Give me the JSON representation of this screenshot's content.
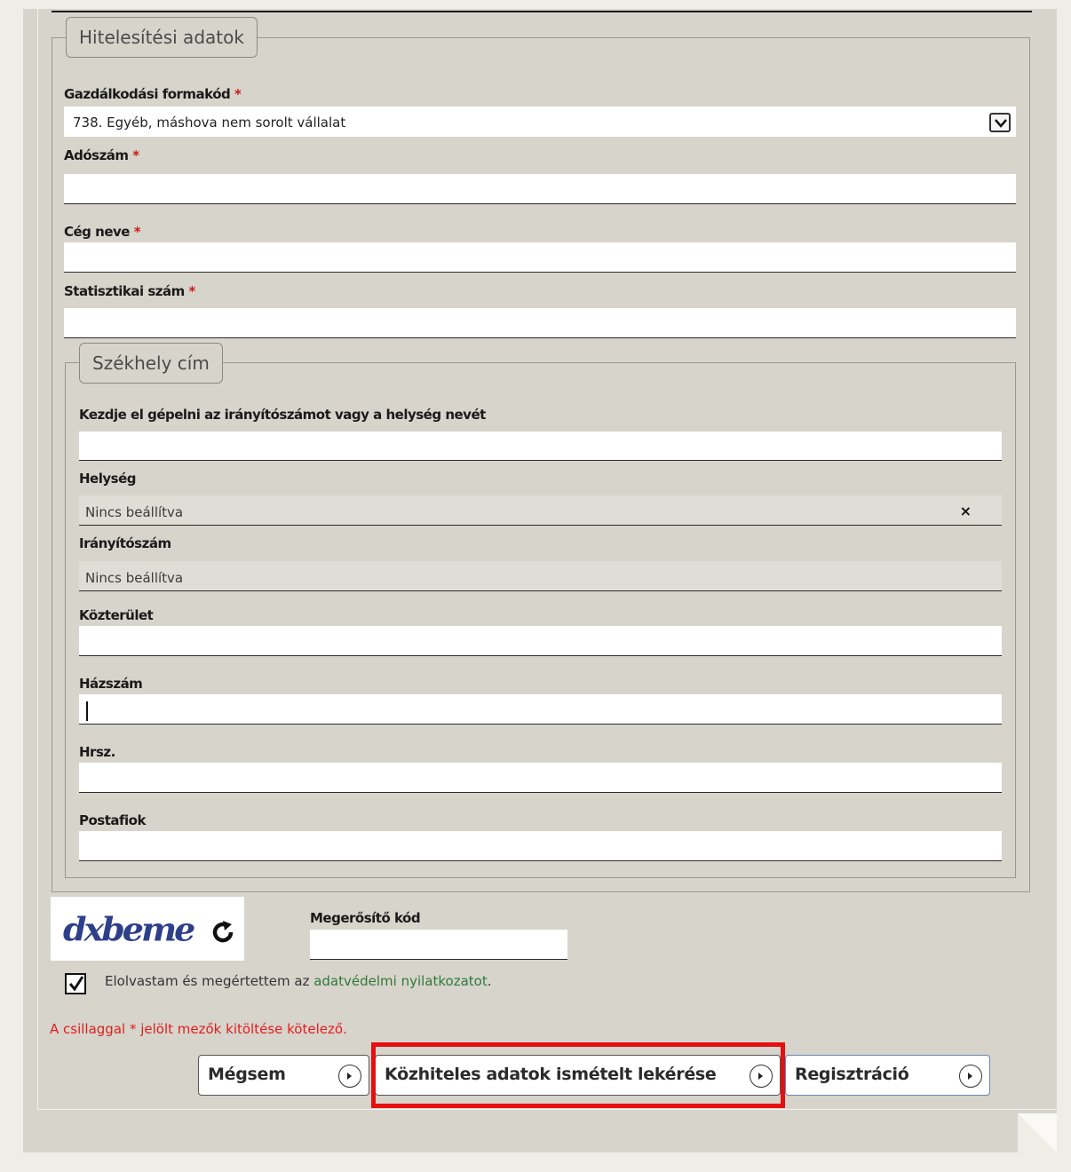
{
  "fieldset_main": {
    "legend": "Hitelesítési adatok"
  },
  "fields": {
    "business_form": {
      "label": "Gazdálkodási formakód",
      "required": "*",
      "value": "738. Egyéb, máshova nem sorolt vállalat"
    },
    "tax_number": {
      "label": "Adószám",
      "required": "*",
      "value": ""
    },
    "company_name": {
      "label": "Cég neve",
      "required": "*",
      "value": ""
    },
    "stat_number": {
      "label": "Statisztikai szám",
      "required": "*",
      "value": ""
    }
  },
  "address": {
    "legend": "Székhely cím",
    "search": {
      "label": "Kezdje el gépelni az irányítószámot vagy a helység nevét",
      "value": ""
    },
    "city": {
      "label": "Helység",
      "value": "Nincs beállítva",
      "clear_icon": "×"
    },
    "zip": {
      "label": "Irányítószám",
      "value": "Nincs beállítva"
    },
    "street": {
      "label": "Közterület",
      "value": ""
    },
    "house_number": {
      "label": "Házszám",
      "value": ""
    },
    "parcel": {
      "label": "Hrsz.",
      "value": ""
    },
    "po_box": {
      "label": "Postafiok",
      "value": ""
    }
  },
  "captcha": {
    "image_text": "dxbeme",
    "code_label": "Megerősítő kód",
    "code_value": "",
    "refresh_icon": "refresh-icon"
  },
  "consent": {
    "checked": true,
    "text": "Elolvastam és megértettem az ",
    "link": "adatvédelmi nyilatkozatot",
    "suffix": "."
  },
  "required_note": "A csillaggal * jelölt mezők kitöltése kötelező.",
  "buttons": {
    "cancel": "Mégsem",
    "refetch": "Közhiteles adatok ismételt lekérése",
    "register": "Regisztráció"
  },
  "colors": {
    "highlight": "#e60f0f",
    "required": "#cc1b1b",
    "link": "#2e7a3a",
    "panel": "#d7d4cb"
  }
}
